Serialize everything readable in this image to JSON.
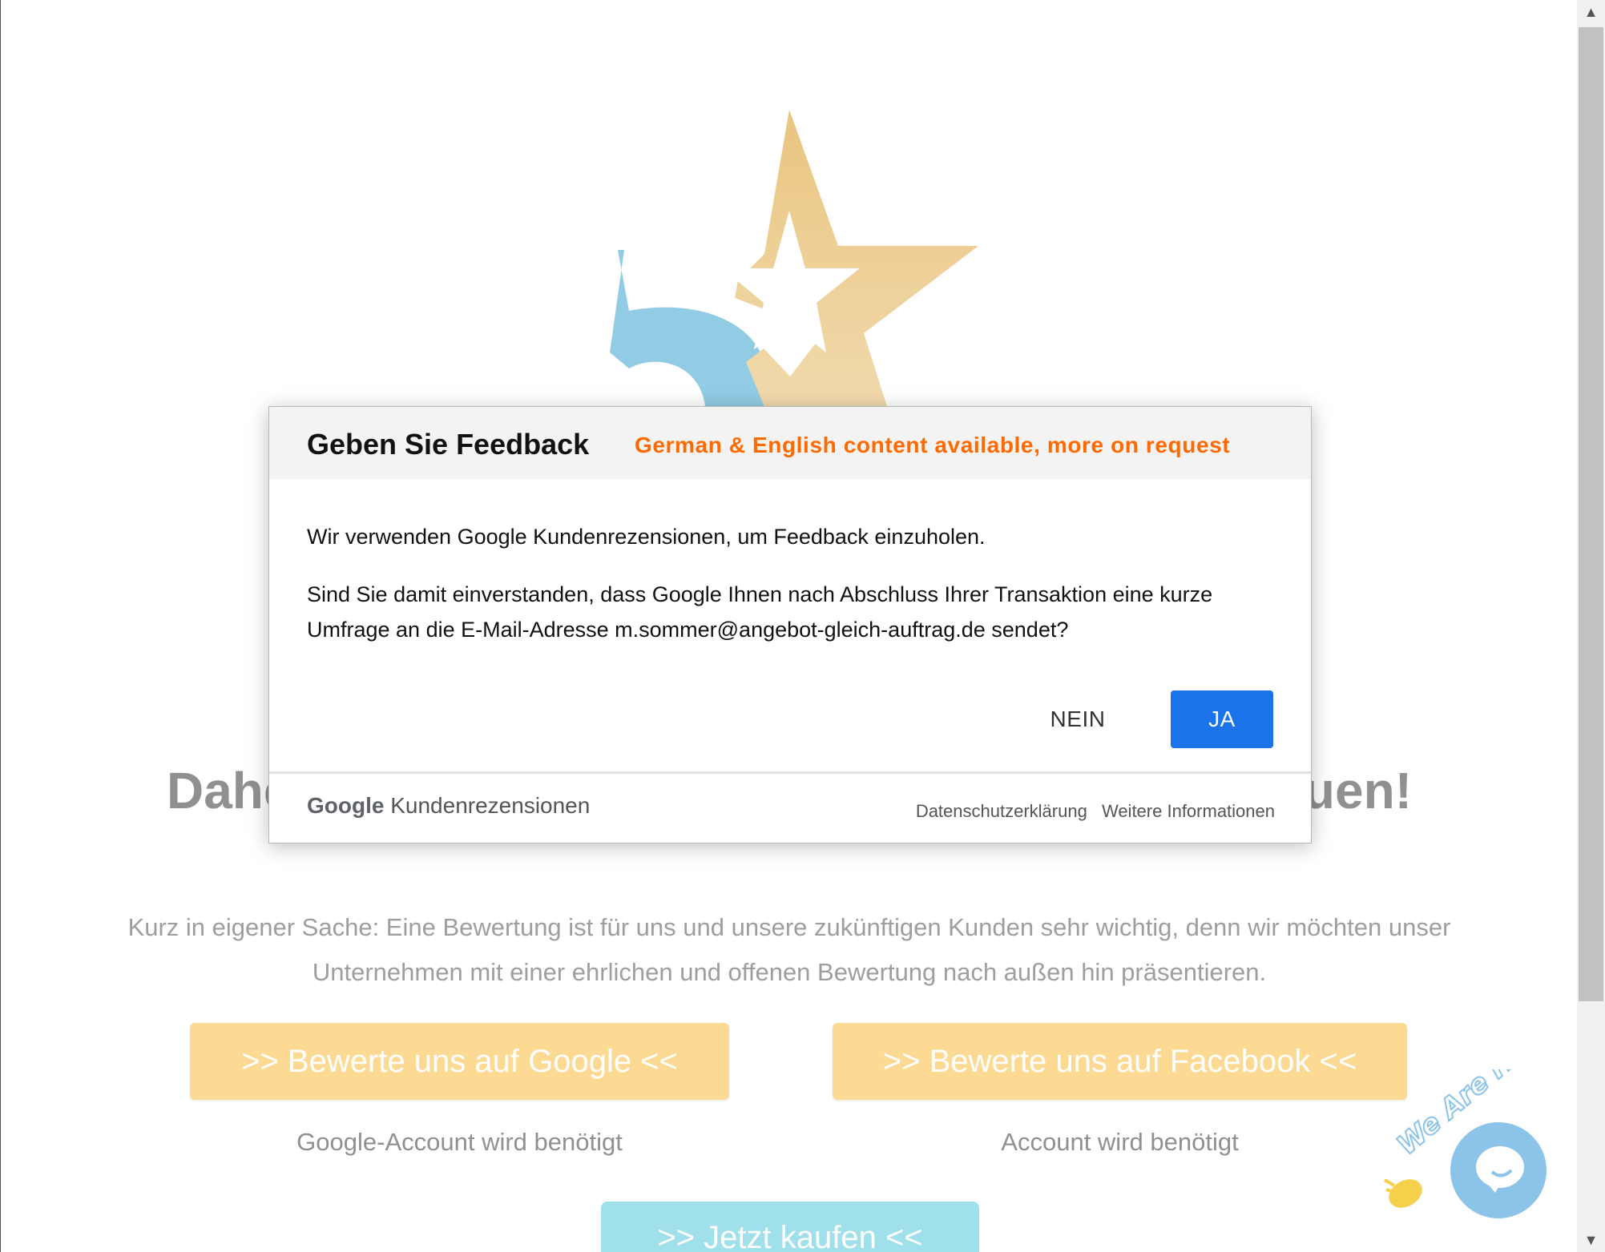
{
  "hero": {
    "headline": "Daher würden wir uns über eine Bewertung freuen!",
    "intro": "Kurz in eigener Sache: Eine Bewertung ist für uns und unsere zukünftigen Kunden sehr wichtig, denn wir möchten unser Unternehmen mit einer ehrlichen und offenen Bewertung nach außen hin präsentieren."
  },
  "buttons": {
    "google_label": ">> Bewerte uns auf Google <<",
    "google_note": "Google-Account wird benötigt",
    "facebook_label": ">> Bewerte uns auf Facebook <<",
    "facebook_note": "Account wird benötigt",
    "buy_label": ">> Jetzt kaufen <<"
  },
  "dialog": {
    "title": "Geben Sie Feedback",
    "note": "German & English content available, more on request",
    "paragraph1": "Wir verwenden Google Kundenrezensionen, um Feedback einzuholen.",
    "paragraph2": "Sind Sie damit einverstanden, dass Google Ihnen nach Abschluss Ihrer Transaktion eine kurze Umfrage an die E-Mail-Adresse m.sommer@angebot-gleich-auftrag.de sendet?",
    "no_label": "NEIN",
    "yes_label": "JA",
    "brand_google": "Google",
    "brand_product": "Kundenrezensionen",
    "privacy_link": "Datenschutzerklärung",
    "more_info_link": "Weitere Informationen"
  },
  "chat": {
    "badge_text": "We Are Here!"
  },
  "colors": {
    "accent_yellow": "#fdd480",
    "accent_blue": "#1a73e8",
    "note_orange": "#ff6a00",
    "buy_button": "#8fdbe8",
    "logo_blue": "#7ec4e0",
    "logo_gold": "#e8c27a"
  },
  "icons": {
    "logo": "five-star-logo-icon",
    "chat": "chat-bubble-icon",
    "wave": "waving-hand-icon"
  }
}
